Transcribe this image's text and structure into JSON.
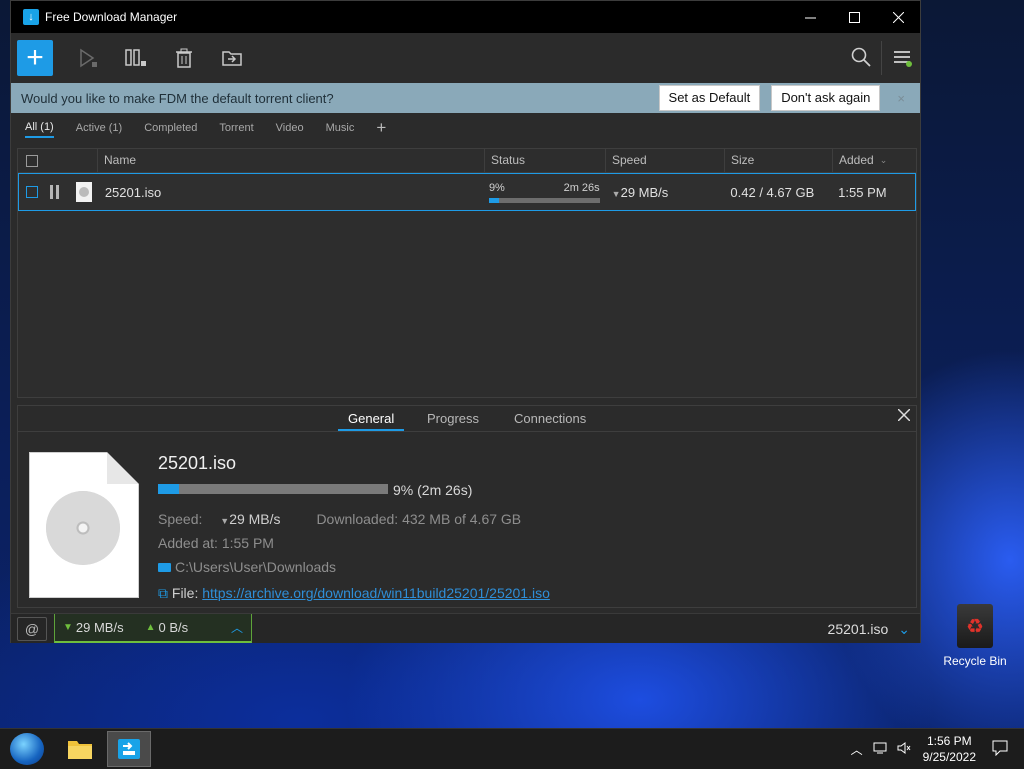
{
  "window": {
    "title": "Free Download Manager"
  },
  "toolbar": {
    "add_button": "+"
  },
  "banner": {
    "message": "Would you like to make FDM the default torrent client?",
    "set_default": "Set as Default",
    "dont_ask": "Don't ask again",
    "close": "×"
  },
  "filters": {
    "items": [
      "All (1)",
      "Active (1)",
      "Completed",
      "Torrent",
      "Video",
      "Music"
    ],
    "add": "+"
  },
  "list": {
    "columns": {
      "name": "Name",
      "status": "Status",
      "speed": "Speed",
      "size": "Size",
      "added": "Added"
    },
    "rows": [
      {
        "name": "25201.iso",
        "status_pct": "9%",
        "status_eta": "2m 26s",
        "progress": 9,
        "speed": "29 MB/s",
        "size": "0.42 / 4.67 GB",
        "added": "1:55 PM"
      }
    ]
  },
  "details": {
    "tabs": [
      "General",
      "Progress",
      "Connections"
    ],
    "active_tab": "General",
    "file_name": "25201.iso",
    "progress": 9,
    "progress_text": "9% (2m 26s)",
    "speed_label": "Speed:",
    "speed_value": "29 MB/s",
    "downloaded_label": "Downloaded:",
    "downloaded_value": "432 MB of 4.67 GB",
    "added_label": "Added at:",
    "added_value": "1:55 PM",
    "folder": "C:\\Users\\User\\Downloads",
    "file_label": "File:",
    "file_url": "https://archive.org/download/win11build25201/25201.iso"
  },
  "statusbar": {
    "down_speed": "29 MB/s",
    "up_speed": "0 B/s",
    "current_file": "25201.iso"
  },
  "desktop": {
    "recycle_bin": "Recycle Bin"
  },
  "taskbar": {
    "time": "1:56 PM",
    "date": "9/25/2022"
  },
  "colors": {
    "accent": "#1e9be6",
    "banner": "#8aa9b9",
    "speed_green": "#6fbf3d"
  }
}
